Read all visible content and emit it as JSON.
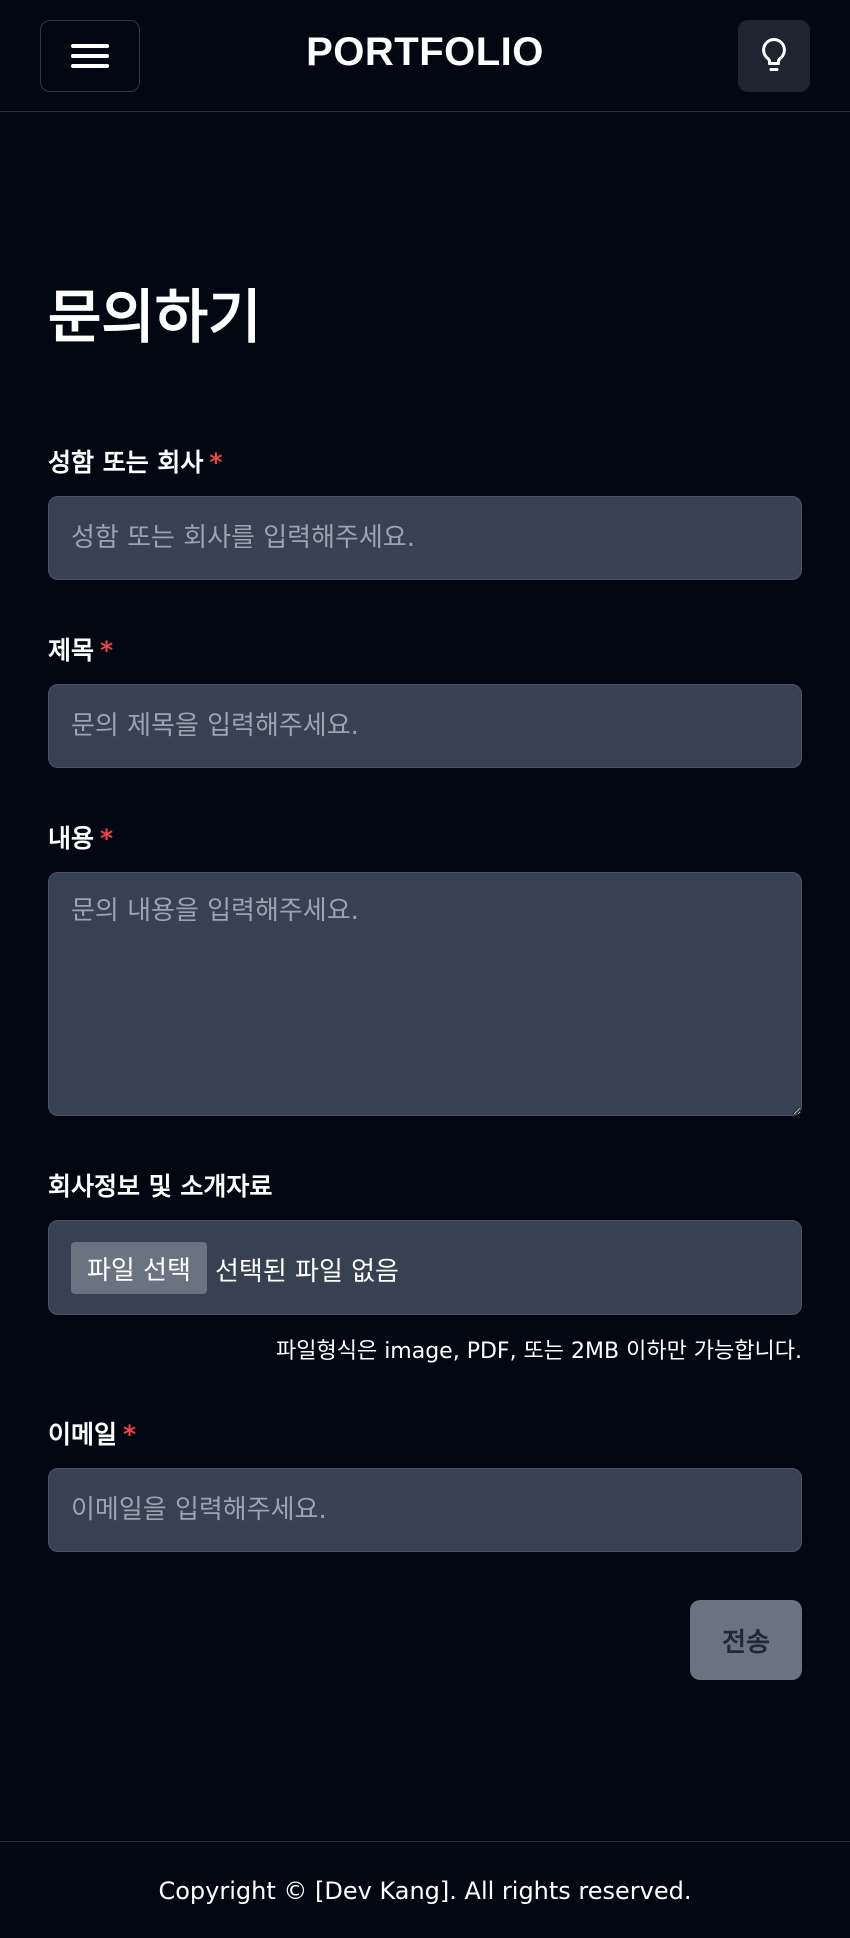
{
  "header": {
    "brand": "PORTFOLIO",
    "menu_icon": "hamburger-menu-icon",
    "theme_icon": "lightbulb-icon"
  },
  "page_title": "문의하기",
  "form": {
    "name": {
      "label": "성함 또는 회사",
      "required_mark": "*",
      "placeholder": "성함 또는 회사를 입력해주세요.",
      "value": ""
    },
    "subject": {
      "label": "제목",
      "required_mark": "*",
      "placeholder": "문의 제목을 입력해주세요.",
      "value": ""
    },
    "content": {
      "label": "내용",
      "required_mark": "*",
      "placeholder": "문의 내용을 입력해주세요.",
      "value": ""
    },
    "file": {
      "label": "회사정보 및 소개자료",
      "button_label": "파일 선택",
      "status": "선택된 파일 없음",
      "hint": "파일형식은 image, PDF, 또는 2MB 이하만 가능합니다."
    },
    "email": {
      "label": "이메일",
      "required_mark": "*",
      "placeholder": "이메일을 입력해주세요.",
      "value": ""
    },
    "submit_label": "전송"
  },
  "footer": {
    "copyright": "Copyright © [Dev Kang]. All rights reserved."
  },
  "colors": {
    "background": "#030711",
    "input_background": "#374151",
    "required": "#ef4444",
    "submit_disabled": "#6b7280"
  }
}
